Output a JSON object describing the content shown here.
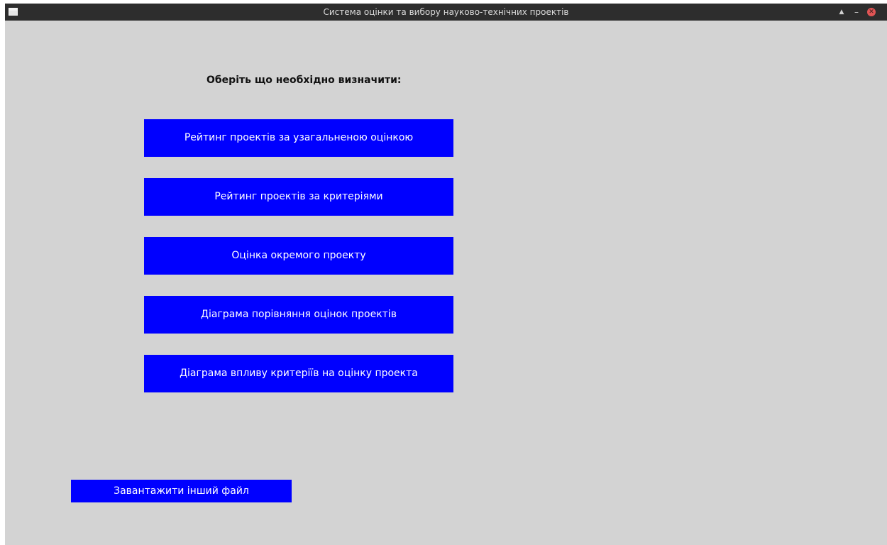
{
  "window": {
    "title": "Система оцінки та вибору науково-технічних проектів",
    "controls": {
      "maximize": "▲",
      "minimize": "–",
      "close": "✕"
    },
    "background_color": "#d3d3d3",
    "titlebar_color": "#2d2d2d"
  },
  "main": {
    "prompt": "Оберіть що необхідно визначити:",
    "buttons": [
      {
        "label": "Рейтинг проектів за узагальненою оцінкою"
      },
      {
        "label": "Рейтинг проектів за критеріями"
      },
      {
        "label": "Оцінка окремого проекту"
      },
      {
        "label": "Діаграма порівняння оцінок проектів"
      },
      {
        "label": "Діаграма впливу критеріїв на оцінку проекта"
      }
    ],
    "button_color": "#0000ff"
  },
  "footer": {
    "load_label": "Завантажити інший файл"
  }
}
